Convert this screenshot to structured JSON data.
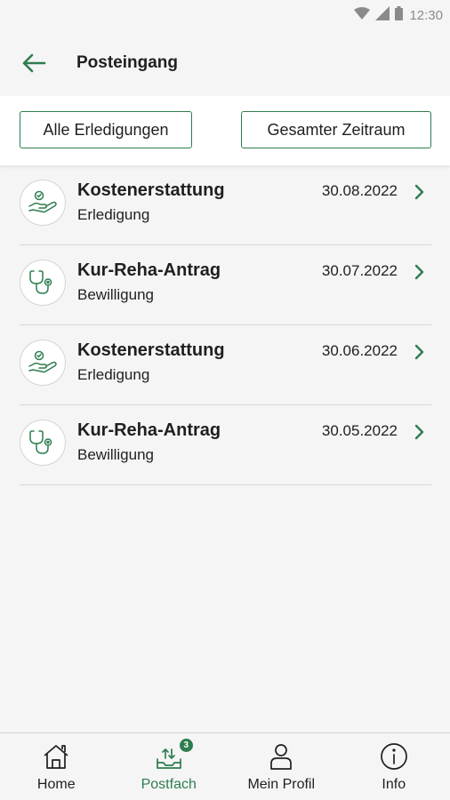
{
  "status_bar": {
    "time": "12:30"
  },
  "header": {
    "title": "Posteingang"
  },
  "filters": {
    "type_label": "Alle Erledigungen",
    "period_label": "Gesamter Zeitraum"
  },
  "messages": [
    {
      "title": "Kostenerstattung",
      "subtitle": "Erledigung",
      "date": "30.08.2022",
      "icon": "hand-money-icon"
    },
    {
      "title": "Kur-Reha-Antrag",
      "subtitle": "Bewilligung",
      "date": "30.07.2022",
      "icon": "stethoscope-icon"
    },
    {
      "title": "Kostenerstattung",
      "subtitle": "Erledigung",
      "date": "30.06.2022",
      "icon": "hand-money-icon"
    },
    {
      "title": "Kur-Reha-Antrag",
      "subtitle": "Bewilligung",
      "date": "30.05.2022",
      "icon": "stethoscope-icon"
    }
  ],
  "bottom_nav": {
    "items": [
      {
        "label": "Home",
        "icon": "home-icon"
      },
      {
        "label": "Postfach",
        "icon": "inbox-icon",
        "badge": "3",
        "active": true
      },
      {
        "label": "Mein Profil",
        "icon": "profile-icon"
      },
      {
        "label": "Info",
        "icon": "info-icon"
      }
    ]
  },
  "colors": {
    "accent": "#2e7d4f",
    "background": "#f5f5f5",
    "divider": "#d9d9d9"
  }
}
